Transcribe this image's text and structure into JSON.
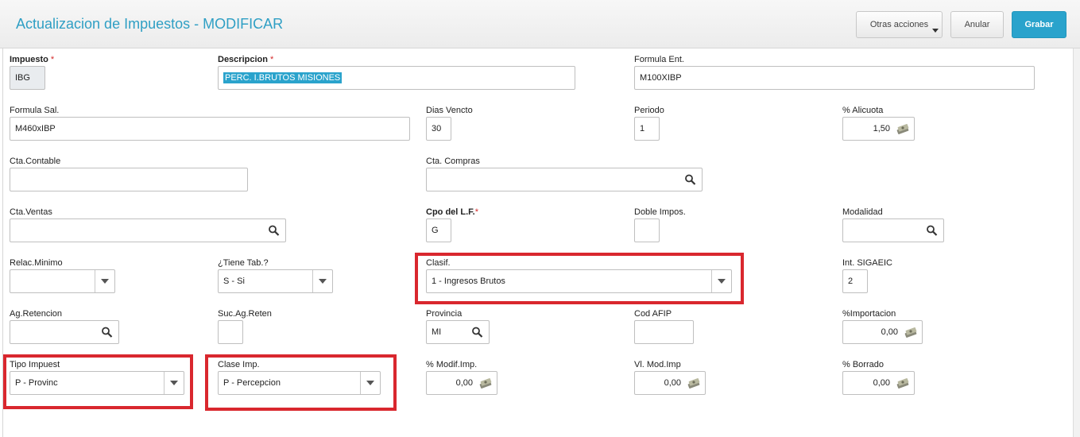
{
  "header": {
    "title": "Actualizacion de Impuestos - MODIFICAR",
    "other_actions": "Otras acciones",
    "cancel": "Anular",
    "save": "Grabar"
  },
  "accent_color": "#2aa3cc",
  "highlight_color": "#d9272e",
  "fields": {
    "impuesto": {
      "label": "Impuesto",
      "required": "*",
      "value": "IBG"
    },
    "descripcion": {
      "label": "Descripcion",
      "required": "*",
      "value": "PERC. I.BRUTOS MISIONES"
    },
    "formula_ent": {
      "label": "Formula Ent.",
      "value": "M100XIBP"
    },
    "formula_sal": {
      "label": "Formula Sal.",
      "value": "M460xIBP"
    },
    "dias_vencto": {
      "label": "Dias Vencto",
      "value": "30"
    },
    "periodo": {
      "label": "Periodo",
      "value": "1"
    },
    "alicuota": {
      "label": "% Alicuota",
      "value": "1,50"
    },
    "cta_contable": {
      "label": "Cta.Contable",
      "value": ""
    },
    "cta_compras": {
      "label": "Cta. Compras",
      "value": ""
    },
    "cta_ventas": {
      "label": "Cta.Ventas",
      "value": ""
    },
    "cpo_lf": {
      "label": "Cpo del L.F.",
      "required": "*",
      "value": "G"
    },
    "doble_impos": {
      "label": "Doble Impos.",
      "value": ""
    },
    "modalidad": {
      "label": "Modalidad",
      "value": ""
    },
    "relac_minimo": {
      "label": "Relac.Minimo",
      "value": ""
    },
    "tiene_tab": {
      "label": "¿Tiene Tab.?",
      "value": "S -  Si"
    },
    "clasif": {
      "label": "Clasif.",
      "value": "1 - Ingresos Brutos"
    },
    "int_sigaeic": {
      "label": "Int. SIGAEIC",
      "value": "2"
    },
    "ag_retencion": {
      "label": "Ag.Retencion",
      "value": ""
    },
    "suc_ag_reten": {
      "label": "Suc.Ag.Reten",
      "value": ""
    },
    "provincia": {
      "label": "Provincia",
      "value": "MI"
    },
    "cod_afip": {
      "label": "Cod AFIP",
      "value": ""
    },
    "importacion": {
      "label": "%Importacion",
      "value": "0,00"
    },
    "tipo_impuest": {
      "label": "Tipo Impuest",
      "value": "P - Provinc"
    },
    "clase_imp": {
      "label": "Clase Imp.",
      "value": "P - Percepcion"
    },
    "modif_imp": {
      "label": "% Modif.Imp.",
      "value": "0,00"
    },
    "vl_mod_imp": {
      "label": "Vl. Mod.Imp",
      "value": "0,00"
    },
    "borrado": {
      "label": "% Borrado",
      "value": "0,00"
    }
  },
  "icons": {
    "search": "search-icon",
    "money": "money-icon",
    "dropdown": "chevron-down-icon"
  }
}
